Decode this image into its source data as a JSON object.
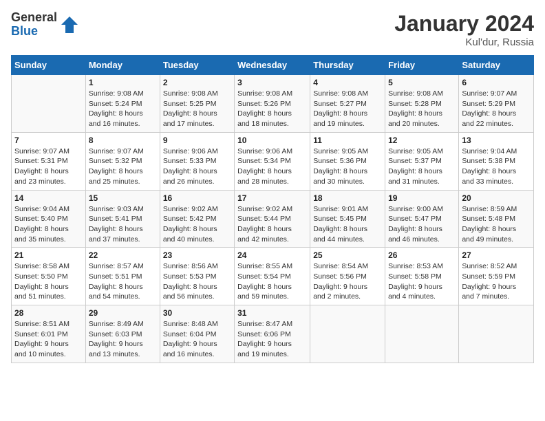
{
  "logo": {
    "general": "General",
    "blue": "Blue"
  },
  "title": "January 2024",
  "location": "Kul'dur, Russia",
  "days_of_week": [
    "Sunday",
    "Monday",
    "Tuesday",
    "Wednesday",
    "Thursday",
    "Friday",
    "Saturday"
  ],
  "weeks": [
    [
      {
        "day": "",
        "info": ""
      },
      {
        "day": "1",
        "info": "Sunrise: 9:08 AM\nSunset: 5:24 PM\nDaylight: 8 hours\nand 16 minutes."
      },
      {
        "day": "2",
        "info": "Sunrise: 9:08 AM\nSunset: 5:25 PM\nDaylight: 8 hours\nand 17 minutes."
      },
      {
        "day": "3",
        "info": "Sunrise: 9:08 AM\nSunset: 5:26 PM\nDaylight: 8 hours\nand 18 minutes."
      },
      {
        "day": "4",
        "info": "Sunrise: 9:08 AM\nSunset: 5:27 PM\nDaylight: 8 hours\nand 19 minutes."
      },
      {
        "day": "5",
        "info": "Sunrise: 9:08 AM\nSunset: 5:28 PM\nDaylight: 8 hours\nand 20 minutes."
      },
      {
        "day": "6",
        "info": "Sunrise: 9:07 AM\nSunset: 5:29 PM\nDaylight: 8 hours\nand 22 minutes."
      }
    ],
    [
      {
        "day": "7",
        "info": "Sunrise: 9:07 AM\nSunset: 5:31 PM\nDaylight: 8 hours\nand 23 minutes."
      },
      {
        "day": "8",
        "info": "Sunrise: 9:07 AM\nSunset: 5:32 PM\nDaylight: 8 hours\nand 25 minutes."
      },
      {
        "day": "9",
        "info": "Sunrise: 9:06 AM\nSunset: 5:33 PM\nDaylight: 8 hours\nand 26 minutes."
      },
      {
        "day": "10",
        "info": "Sunrise: 9:06 AM\nSunset: 5:34 PM\nDaylight: 8 hours\nand 28 minutes."
      },
      {
        "day": "11",
        "info": "Sunrise: 9:05 AM\nSunset: 5:36 PM\nDaylight: 8 hours\nand 30 minutes."
      },
      {
        "day": "12",
        "info": "Sunrise: 9:05 AM\nSunset: 5:37 PM\nDaylight: 8 hours\nand 31 minutes."
      },
      {
        "day": "13",
        "info": "Sunrise: 9:04 AM\nSunset: 5:38 PM\nDaylight: 8 hours\nand 33 minutes."
      }
    ],
    [
      {
        "day": "14",
        "info": "Sunrise: 9:04 AM\nSunset: 5:40 PM\nDaylight: 8 hours\nand 35 minutes."
      },
      {
        "day": "15",
        "info": "Sunrise: 9:03 AM\nSunset: 5:41 PM\nDaylight: 8 hours\nand 37 minutes."
      },
      {
        "day": "16",
        "info": "Sunrise: 9:02 AM\nSunset: 5:42 PM\nDaylight: 8 hours\nand 40 minutes."
      },
      {
        "day": "17",
        "info": "Sunrise: 9:02 AM\nSunset: 5:44 PM\nDaylight: 8 hours\nand 42 minutes."
      },
      {
        "day": "18",
        "info": "Sunrise: 9:01 AM\nSunset: 5:45 PM\nDaylight: 8 hours\nand 44 minutes."
      },
      {
        "day": "19",
        "info": "Sunrise: 9:00 AM\nSunset: 5:47 PM\nDaylight: 8 hours\nand 46 minutes."
      },
      {
        "day": "20",
        "info": "Sunrise: 8:59 AM\nSunset: 5:48 PM\nDaylight: 8 hours\nand 49 minutes."
      }
    ],
    [
      {
        "day": "21",
        "info": "Sunrise: 8:58 AM\nSunset: 5:50 PM\nDaylight: 8 hours\nand 51 minutes."
      },
      {
        "day": "22",
        "info": "Sunrise: 8:57 AM\nSunset: 5:51 PM\nDaylight: 8 hours\nand 54 minutes."
      },
      {
        "day": "23",
        "info": "Sunrise: 8:56 AM\nSunset: 5:53 PM\nDaylight: 8 hours\nand 56 minutes."
      },
      {
        "day": "24",
        "info": "Sunrise: 8:55 AM\nSunset: 5:54 PM\nDaylight: 8 hours\nand 59 minutes."
      },
      {
        "day": "25",
        "info": "Sunrise: 8:54 AM\nSunset: 5:56 PM\nDaylight: 9 hours\nand 2 minutes."
      },
      {
        "day": "26",
        "info": "Sunrise: 8:53 AM\nSunset: 5:58 PM\nDaylight: 9 hours\nand 4 minutes."
      },
      {
        "day": "27",
        "info": "Sunrise: 8:52 AM\nSunset: 5:59 PM\nDaylight: 9 hours\nand 7 minutes."
      }
    ],
    [
      {
        "day": "28",
        "info": "Sunrise: 8:51 AM\nSunset: 6:01 PM\nDaylight: 9 hours\nand 10 minutes."
      },
      {
        "day": "29",
        "info": "Sunrise: 8:49 AM\nSunset: 6:03 PM\nDaylight: 9 hours\nand 13 minutes."
      },
      {
        "day": "30",
        "info": "Sunrise: 8:48 AM\nSunset: 6:04 PM\nDaylight: 9 hours\nand 16 minutes."
      },
      {
        "day": "31",
        "info": "Sunrise: 8:47 AM\nSunset: 6:06 PM\nDaylight: 9 hours\nand 19 minutes."
      },
      {
        "day": "",
        "info": ""
      },
      {
        "day": "",
        "info": ""
      },
      {
        "day": "",
        "info": ""
      }
    ]
  ]
}
